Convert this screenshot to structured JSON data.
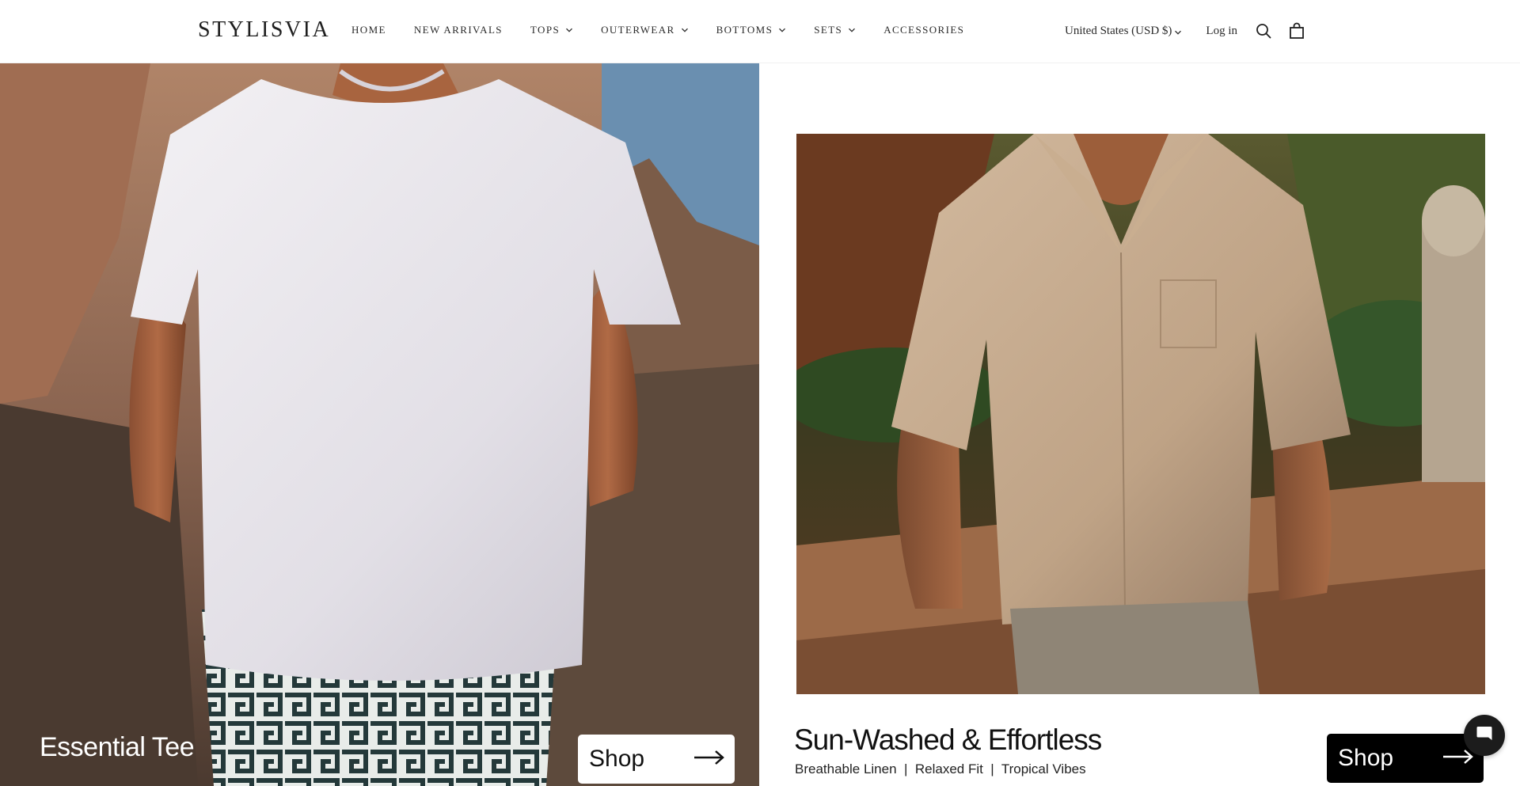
{
  "header": {
    "logo": "STYLISVIA",
    "nav": [
      {
        "label": "HOME",
        "has_dropdown": false
      },
      {
        "label": "NEW ARRIVALS",
        "has_dropdown": false
      },
      {
        "label": "TOPS",
        "has_dropdown": true
      },
      {
        "label": "OUTERWEAR",
        "has_dropdown": true
      },
      {
        "label": "BOTTOMS",
        "has_dropdown": true
      },
      {
        "label": "SETS",
        "has_dropdown": true
      },
      {
        "label": "ACCESSORIES",
        "has_dropdown": false
      }
    ],
    "country_selector": "United States (USD $)",
    "login": "Log in",
    "icons": [
      "search-icon",
      "cart-icon"
    ]
  },
  "hero_left": {
    "title": "Essential Tee",
    "button_label": "Shop",
    "button_icon": "arrow-right-icon"
  },
  "hero_right": {
    "title": "Sun-Washed & Effortless",
    "subtitle": "Breathable Linen  |  Relaxed Fit  |  Tropical Vibes",
    "button_label": "Shop",
    "button_icon": "arrow-right-icon"
  },
  "chat": {
    "icon": "chat-bubble-icon"
  },
  "colors": {
    "header_bg": "#ffffff",
    "text": "#1a1a1a",
    "shop_light_bg": "#ffffff",
    "shop_dark_bg": "#000000"
  }
}
